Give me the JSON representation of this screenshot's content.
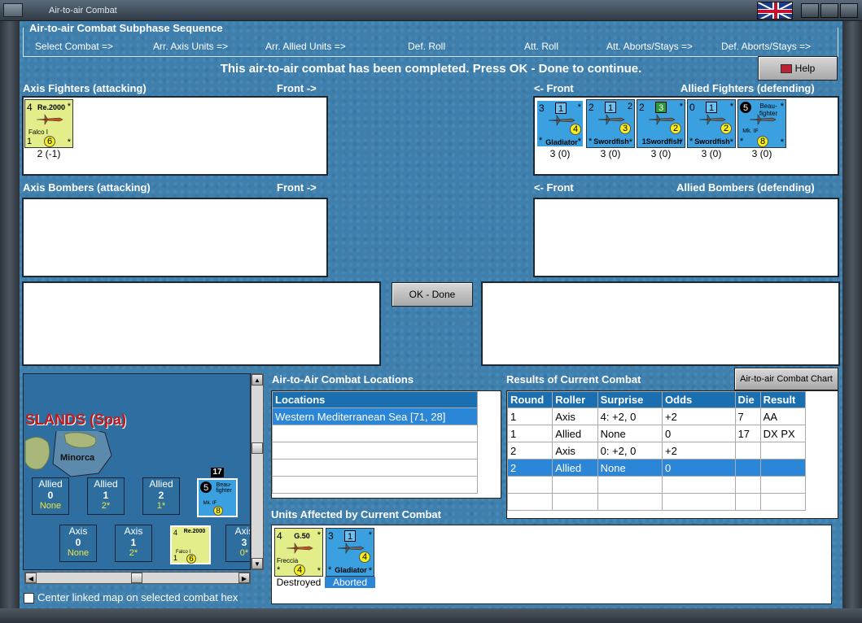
{
  "window": {
    "title": "Air-to-air Combat"
  },
  "sequence": {
    "title": "Air-to-air Combat Subphase Sequence",
    "steps": [
      "Select Combat =>",
      "Arr. Axis Units =>",
      "Arr. Allied Units =>",
      "Def. Roll",
      "Att. Roll",
      "Att. Aborts/Stays =>",
      "Def. Aborts/Stays =>"
    ]
  },
  "message": "This air-to-air combat has been completed.  Press OK - Done to continue.",
  "help_label": "Help",
  "panels": {
    "axis_fighters": "Axis Fighters (attacking)",
    "axis_front": "Front ->",
    "allied_front": "<- Front",
    "allied_fighters": "Allied Fighters (defending)",
    "axis_bombers": "Axis Bombers (attacking)",
    "axis_bombers_front": "Front ->",
    "allied_bombers_front": "<- Front",
    "allied_bombers": "Allied Bombers (defending)"
  },
  "ok_label": "OK - Done",
  "axis_fighter_units": [
    {
      "tl": "4",
      "name": "Re.2000",
      "tr": "*",
      "sub": "Falco I",
      "bl": "1",
      "dot": "6",
      "br": "*",
      "val": "2 (-1)"
    }
  ],
  "allied_fighter_units": [
    {
      "tl": "3",
      "badge": "1",
      "tr": "*",
      "dot": "4",
      "name": "Gladiator",
      "bl": "*",
      "br": "*",
      "val": "3 (0)"
    },
    {
      "tl": "2",
      "badge": "1",
      "tr": "2",
      "dot": "3",
      "name": "Swordfish",
      "bl": "*",
      "br": "*",
      "val": "3 (0)"
    },
    {
      "tl": "2",
      "badge": "3",
      "tr": "*",
      "dot": "2",
      "name": "1Swordfish",
      "bl": "",
      "br": "*",
      "val": "3 (0)"
    },
    {
      "tl": "0",
      "badge": "1",
      "tr": "*",
      "dot": "2",
      "name": "Swordfish",
      "bl": "*",
      "br": "*",
      "val": "3 (0)"
    },
    {
      "tl": "5",
      "badge": "",
      "name": "Beau-fighter",
      "sub": "Mk. IF",
      "tr": "*",
      "dot": "8",
      "bl": "*",
      "br": "*",
      "val": "3 (0)"
    }
  ],
  "map": {
    "region_label": "SLANDS (Spa)",
    "hex_label": "Minorca",
    "stack_count": "17",
    "allied_cells": [
      {
        "side": "Allied",
        "n": "0",
        "y": "None"
      },
      {
        "side": "Allied",
        "n": "1",
        "y": "2*"
      },
      {
        "side": "Allied",
        "n": "2",
        "y": "1*"
      }
    ],
    "axis_cells": [
      {
        "side": "Axis",
        "n": "0",
        "y": "None"
      },
      {
        "side": "Axis",
        "n": "1",
        "y": "2*"
      },
      {
        "side": "Axis",
        "n": "3",
        "y": "0*"
      }
    ],
    "allied_unit": {
      "tl": "5",
      "name": "Beau-fighter",
      "sub": "Mk. IF",
      "dot": "8",
      "tr": "*",
      "bl": "*",
      "br": "*"
    },
    "axis_unit": {
      "tl": "4",
      "name": "Re.2000",
      "sub": "Falco I",
      "bl": "1",
      "dot": "6",
      "tr": "*",
      "br": "*"
    },
    "center_checkbox_label": "Center linked map on selected combat hex"
  },
  "locations": {
    "title": "Air-to-Air Combat Locations",
    "header": "Locations",
    "rows": [
      "Western Mediterranean Sea [71, 28]"
    ]
  },
  "results": {
    "title": "Results of Current Combat",
    "chart_button": "Air-to-air Combat Chart",
    "headers": [
      "Round",
      "Roller",
      "Surprise",
      "Odds",
      "Die",
      "Result"
    ],
    "rows": [
      [
        "1",
        "Axis",
        "4: +2, 0",
        "+2",
        "7",
        "AA"
      ],
      [
        "1",
        "Allied",
        "None",
        "0",
        "17",
        "DX PX"
      ],
      [
        "2",
        "Axis",
        "0: +2, 0",
        "+2",
        "",
        ""
      ],
      [
        "2",
        "Allied",
        "None",
        "0",
        "",
        ""
      ]
    ]
  },
  "affected": {
    "title": "Units Affected by Current Combat",
    "units": [
      {
        "tl": "4",
        "name": "G.50",
        "tr": "*",
        "sub": "Freccia",
        "dot": "4",
        "bl": "*",
        "br": "*",
        "status": "Destroyed"
      },
      {
        "tl": "3",
        "badge": "1",
        "tr": "*",
        "dot": "4",
        "name": "Gladiator",
        "bl": "*",
        "br": "*",
        "status": "Aborted"
      }
    ]
  }
}
